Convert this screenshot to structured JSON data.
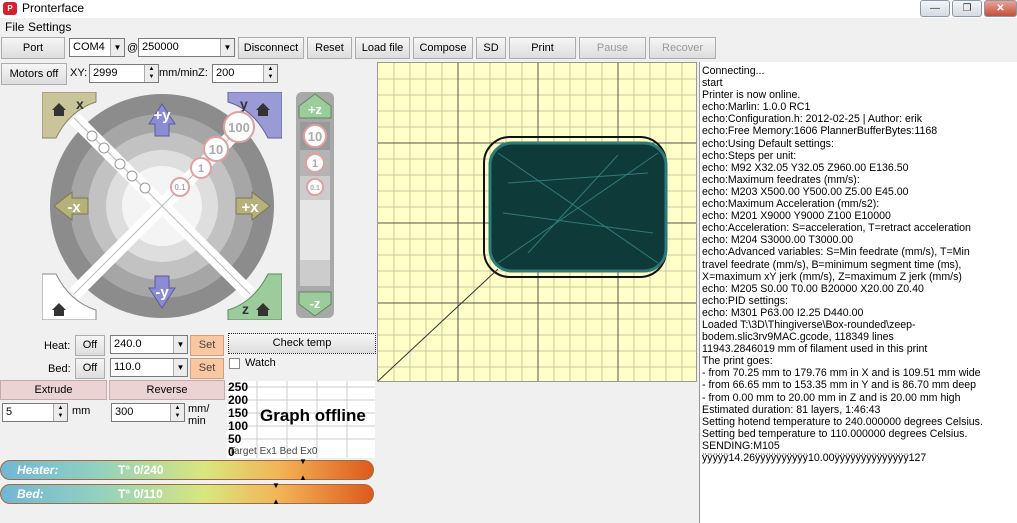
{
  "window": {
    "title": "Pronterface",
    "min_glyph": "—",
    "max_glyph": "❐",
    "close_glyph": "✕"
  },
  "menu": {
    "file": "File",
    "settings": "Settings"
  },
  "toolbar": {
    "port": "Port",
    "port_value": "COM4",
    "at": "@",
    "baud_value": "250000",
    "disconnect": "Disconnect",
    "reset": "Reset",
    "load_file": "Load file",
    "compose": "Compose",
    "sd": "SD",
    "print": "Print",
    "pause": "Pause",
    "recover": "Recover"
  },
  "motors": {
    "motors_off": "Motors off",
    "xy_label": "XY:",
    "xy_value": "2999",
    "xy_unit": "mm/min",
    "z_label": "Z:",
    "z_value": "200"
  },
  "jog": {
    "plus_y": "+y",
    "minus_y": "-y",
    "plus_x": "+x",
    "minus_x": "-x",
    "home_x": "x",
    "home_y": "y",
    "home_z": "z",
    "step_100": "100",
    "step_10": "10",
    "step_1": "1",
    "step_01": "0.1",
    "z_plus": "+z",
    "z_minus": "-z",
    "z_10": "10",
    "z_1": "1",
    "z_01": "0.1"
  },
  "temps": {
    "heat_label": "Heat:",
    "heat_off": "Off",
    "heat_value": "240.0",
    "heat_set": "Set",
    "bed_label": "Bed:",
    "bed_off": "Off",
    "bed_value": "110.0",
    "bed_set": "Set",
    "check_temp": "Check temp",
    "watch": "Watch"
  },
  "extrude": {
    "extrude": "Extrude",
    "reverse": "Reverse",
    "length_value": "5",
    "length_unit": "mm",
    "speed_value": "300",
    "speed_unit": "mm/ min"
  },
  "graph": {
    "y_ticks": [
      "250",
      "200",
      "150",
      "100",
      "50",
      "0"
    ],
    "offline": "Graph offline",
    "legend": "Target  Ex1 Bed Ex0"
  },
  "gauges": {
    "heater_label": "Heater:",
    "heater_value": "T° 0/240",
    "bed_label": "Bed:",
    "bed_value": "T° 0/110"
  },
  "log_lines": [
    "Connecting...",
    "start",
    "Printer is now online.",
    "echo:Marlin: 1.0.0 RC1",
    "echo:Configuration.h: 2012-02-25 | Author: erik",
    "echo:Free Memory:1606  PlannerBufferBytes:1168",
    "echo:Using Default settings:",
    "echo:Steps per unit:",
    "echo:  M92 X32.05 Y32.05 Z960.00 E136.50",
    "echo:Maximum feedrates (mm/s):",
    "echo:  M203 X500.00 Y500.00 Z5.00 E45.00",
    "echo:Maximum Acceleration (mm/s2):",
    "echo:  M201 X9000 Y9000 Z100 E10000",
    "echo:Acceleration: S=acceleration, T=retract acceleration",
    "echo:  M204 S3000.00 T3000.00",
    "echo:Advanced variables: S=Min feedrate (mm/s), T=Min",
    "travel feedrate (mm/s), B=minimum segment time (ms),",
    "X=maximum xY jerk (mm/s),  Z=maximum Z jerk (mm/s)",
    "echo:  M205 S0.00 T0.00 B20000 X20.00 Z0.40",
    "echo:PID settings:",
    "echo:   M301 P63.00 I2.25 D440.00",
    "Loaded T:\\3D\\Thingiverse\\Box-rounded\\zeep-",
    "bodem.slic3rv9MAC.gcode, 118349 lines",
    "11943.2846019 mm of filament used in this print",
    "The print goes:",
    "- from 70.25 mm to 179.76 mm in X and is 109.51 mm wide",
    "- from 66.65 mm to 153.35 mm in Y and is 86.70 mm deep",
    "- from 0.00 mm to 20.00 mm in Z and is 20.00 mm high",
    "Estimated duration: 81 layers, 1:46:43",
    "Setting hotend temperature to 240.000000 degrees Celsius.",
    "Setting bed temperature to 110.000000 degrees Celsius.",
    "SENDING:M105",
    "ÿÿÿÿÿ14.26ÿÿÿÿÿÿÿÿÿÿ10.00ÿÿÿÿÿÿÿÿÿÿÿÿÿÿ127"
  ]
}
